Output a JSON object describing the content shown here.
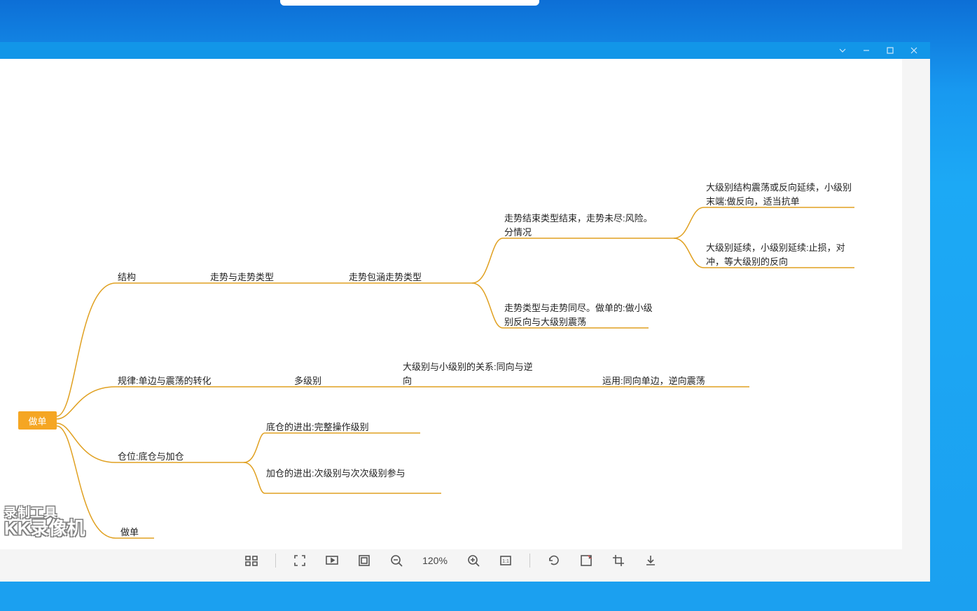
{
  "window_controls": {
    "dropdown": "v",
    "minimize": "–",
    "maximize": "□",
    "close": "×"
  },
  "mindmap": {
    "root": "做单",
    "b1": {
      "label": "结构",
      "c1": {
        "label": "走势与走势类型",
        "d1": {
          "label": "走势包涵走势类型",
          "e1": {
            "label": "走势结束类型结束，走势未尽:风险。分情况",
            "f1": "大级别结构震荡或反向延续，小级别末端:做反向，适当抗单",
            "f2": "大级别延续，小级别延续:止损，对冲，等大级别的反向"
          },
          "e2": "走势类型与走势同尽。做单的:做小级别反向与大级别震荡"
        }
      }
    },
    "b2": {
      "label": "规律:单边与震荡的转化",
      "c1": {
        "label": "多级别",
        "d1": {
          "label": "大级别与小级别的关系:同向与逆向",
          "e1": "运用:同向单边，逆向震荡"
        }
      }
    },
    "b3": {
      "label": "仓位:底仓与加仓",
      "c1": "底仓的进出:完整操作级别",
      "c2": "加仓的进出:次级别与次次级别参与"
    },
    "b4": {
      "label": "做单"
    }
  },
  "toolbar": {
    "zoom_pct": "120%"
  },
  "watermark": {
    "line1": "录制工具",
    "line2": "KK录像机"
  }
}
